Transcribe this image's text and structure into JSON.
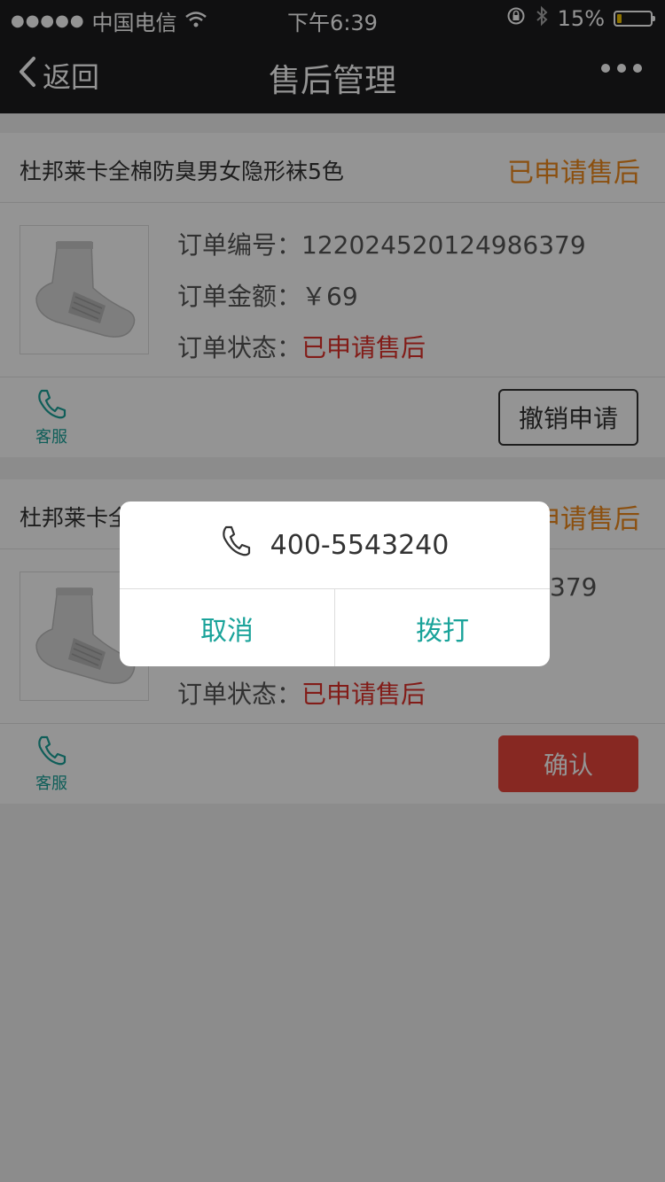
{
  "status_bar": {
    "signal_dots": "●●●●●",
    "carrier": "中国电信",
    "time": "下午6:39",
    "battery_percent": "15%",
    "battery_level": 0.15
  },
  "navbar": {
    "back_label": "返回",
    "title": "售后管理"
  },
  "orders": [
    {
      "title": "杜邦莱卡全棉防臭男女隐形袜5色",
      "status_label": "已申请售后",
      "order_number_label": "订单编号：",
      "order_number": "122024520124986379",
      "amount_label": "订单金额：",
      "amount": "￥69",
      "state_label": "订单状态：",
      "state": "已申请售后",
      "service_label": "客服",
      "action_label": "撤销申请"
    },
    {
      "title": "杜邦莱卡全",
      "status_label": "已申请售后",
      "order_number_partial": "379",
      "state_label": "订单状态：",
      "state": "已申请售后",
      "service_label": "客服",
      "action_label": "确认"
    }
  ],
  "dialog": {
    "phone": "400-5543240",
    "cancel_label": "取消",
    "call_label": "拨打"
  },
  "colors": {
    "accent_teal": "#1aa39a",
    "status_orange": "#f08a1d",
    "status_red": "#e0312a",
    "confirm_red": "#e8453c",
    "bar_dark": "#1c1c1e"
  }
}
